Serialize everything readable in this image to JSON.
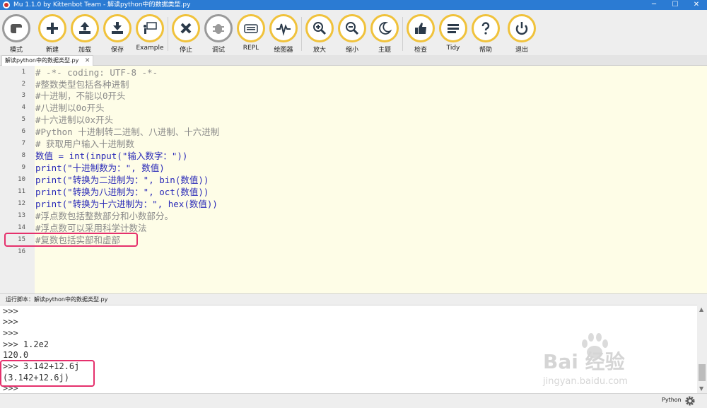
{
  "window": {
    "title": "Mu 1.1.0 by Kittenbot Team - 解读python中的数据类型.py",
    "controls": {
      "minimize": "─",
      "maximize": "☐",
      "close": "✕"
    }
  },
  "toolbar": {
    "buttons": [
      {
        "label": "模式",
        "icon": "mode-icon"
      },
      {
        "label": "新建",
        "icon": "plus-icon"
      },
      {
        "label": "加载",
        "icon": "upload-icon"
      },
      {
        "label": "保存",
        "icon": "download-icon"
      },
      {
        "label": "Example",
        "icon": "example-icon"
      },
      {
        "label": "停止",
        "icon": "close-icon"
      },
      {
        "label": "调试",
        "icon": "bug-icon"
      },
      {
        "label": "REPL",
        "icon": "keyboard-icon"
      },
      {
        "label": "绘图器",
        "icon": "pulse-icon"
      },
      {
        "label": "放大",
        "icon": "zoom-in-icon"
      },
      {
        "label": "缩小",
        "icon": "zoom-out-icon"
      },
      {
        "label": "主题",
        "icon": "moon-icon"
      },
      {
        "label": "检查",
        "icon": "thumbs-up-icon"
      },
      {
        "label": "Tidy",
        "icon": "tidy-icon"
      },
      {
        "label": "帮助",
        "icon": "help-icon"
      },
      {
        "label": "退出",
        "icon": "power-icon"
      }
    ]
  },
  "tabs": [
    {
      "label": "解读python中的数据类型.py",
      "close": "✕"
    }
  ],
  "editor": {
    "lines": [
      {
        "n": "1",
        "text": "# -*- coding: UTF-8 -*-",
        "kind": "comment"
      },
      {
        "n": "2",
        "text": "#整数类型包括各种进制",
        "kind": "comment"
      },
      {
        "n": "3",
        "text": "#十进制，不能以0开头",
        "kind": "comment"
      },
      {
        "n": "4",
        "text": "#八进制以0o开头",
        "kind": "comment"
      },
      {
        "n": "5",
        "text": "#十六进制以0x开头",
        "kind": "comment"
      },
      {
        "n": "6",
        "text": "#Python 十进制转二进制、八进制、十六进制",
        "kind": "comment"
      },
      {
        "n": "7",
        "text": "# 获取用户输入十进制数",
        "kind": "comment"
      },
      {
        "n": "8",
        "text": "数值 = int(input(\"输入数字：\"))",
        "kind": "code"
      },
      {
        "n": "9",
        "text": "print(\"十进制数为：\", 数值)",
        "kind": "code"
      },
      {
        "n": "10",
        "text": "print(\"转换为二进制为：\", bin(数值))",
        "kind": "code"
      },
      {
        "n": "11",
        "text": "print(\"转换为八进制为：\", oct(数值))",
        "kind": "code"
      },
      {
        "n": "12",
        "text": "print(\"转换为十六进制为：\", hex(数值))",
        "kind": "code"
      },
      {
        "n": "13",
        "text": "#浮点数包括整数部分和小数部分。",
        "kind": "comment"
      },
      {
        "n": "14",
        "text": "#浮点数可以采用科学计数法",
        "kind": "comment"
      },
      {
        "n": "15",
        "text": "#复数包括实部和虚部",
        "kind": "comment"
      },
      {
        "n": "16",
        "text": "",
        "kind": "comment"
      }
    ]
  },
  "repl": {
    "header": "运行脚本：解读python中的数据类型.py",
    "lines": [
      ">>>",
      ">>>",
      ">>>",
      ">>> 1.2e2",
      "120.0",
      ">>> 3.142+12.6j",
      "(3.142+12.6j)",
      ">>> "
    ]
  },
  "status": {
    "mode": "Python",
    "settings_icon": "gear-icon"
  },
  "watermark": {
    "brand": "Bai 经验",
    "url": "jingyan.baidu.com"
  },
  "colors": {
    "titlebar": "#2b7bd3",
    "button_ring": "#f0c23b",
    "editor_bg": "#fefde7",
    "highlight": "#e5306c"
  }
}
